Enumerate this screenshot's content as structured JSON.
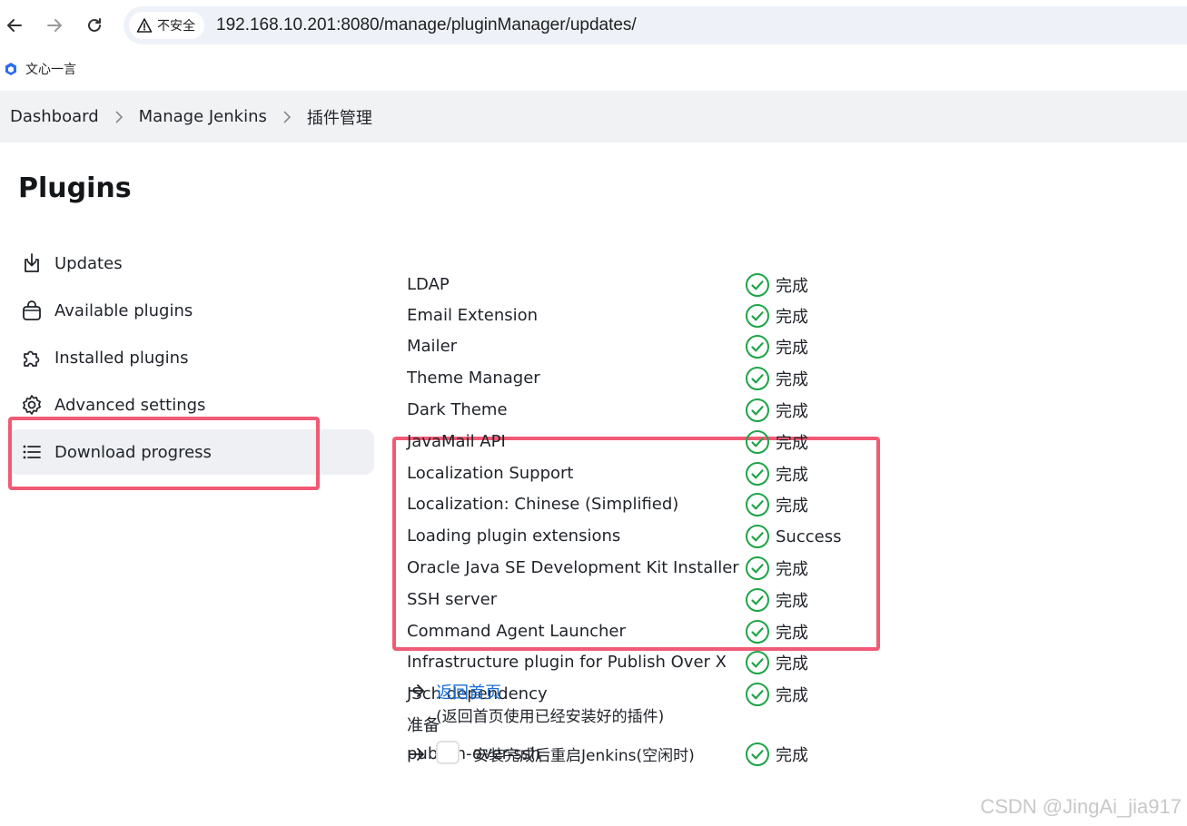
{
  "browser": {
    "security_label": "不安全",
    "url": "192.168.10.201:8080/manage/pluginManager/updates/",
    "bookmark_label": "文心一言"
  },
  "breadcrumb": {
    "items": [
      "Dashboard",
      "Manage Jenkins",
      "插件管理"
    ]
  },
  "sidebar": {
    "title": "Plugins",
    "items": [
      {
        "label": "Updates",
        "icon": "download-icon"
      },
      {
        "label": "Available plugins",
        "icon": "shopping-bag-icon"
      },
      {
        "label": "Installed plugins",
        "icon": "puzzle-icon"
      },
      {
        "label": "Advanced settings",
        "icon": "gear-icon"
      },
      {
        "label": "Download progress",
        "icon": "list-icon",
        "active": true
      }
    ]
  },
  "progress": {
    "rows": [
      {
        "name": "LDAP",
        "status": "完成"
      },
      {
        "name": "Email Extension",
        "status": "完成"
      },
      {
        "name": "Mailer",
        "status": "完成"
      },
      {
        "name": "Theme Manager",
        "status": "完成"
      },
      {
        "name": "Dark Theme",
        "status": "完成"
      },
      {
        "name": "JavaMail API",
        "status": "完成"
      },
      {
        "name": "Localization Support",
        "status": "完成"
      },
      {
        "name": "Localization: Chinese (Simplified)",
        "status": "完成"
      },
      {
        "name": "Loading plugin extensions",
        "status": "Success"
      },
      {
        "name": "Oracle Java SE Development Kit Installer",
        "status": "完成"
      },
      {
        "name": "SSH server",
        "status": "完成"
      },
      {
        "name": "Command Agent Launcher",
        "status": "完成"
      },
      {
        "name": "Infrastructure plugin for Publish Over X",
        "status": "完成"
      },
      {
        "name": "JSch dependency",
        "status": "完成"
      },
      {
        "name": "准备",
        "status": ""
      },
      {
        "name": "publish-over-ssh",
        "status": "完成"
      }
    ]
  },
  "actions": {
    "home_link": "返回首页",
    "home_note": "(返回首页使用已经安装好的插件)",
    "restart_label": "安装完成后重启Jenkins(空闲时)"
  },
  "watermark": "CSDN @JingAi_jia917",
  "colors": {
    "success": "#1ea446",
    "link": "#1a6ed8",
    "highlight": "#f05a75"
  }
}
